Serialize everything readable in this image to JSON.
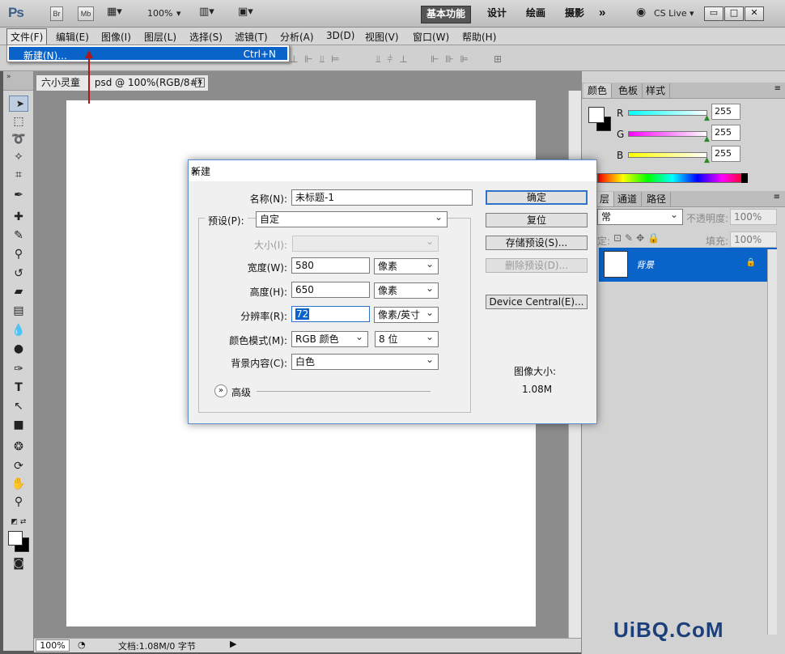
{
  "appbar": {
    "logo": "Ps",
    "br": "Br",
    "mb": "Mb",
    "zoom": "100%",
    "workspaces": [
      "基本功能",
      "设计",
      "绘画",
      "摄影"
    ],
    "more": "»",
    "cs_live": "CS Live",
    "win_min": "▭",
    "win_restore": "□",
    "win_close": "✕"
  },
  "menu": [
    "文件(F)",
    "编辑(E)",
    "图像(I)",
    "图层(L)",
    "选择(S)",
    "滤镜(T)",
    "分析(A)",
    "3D(D)",
    "视图(V)",
    "窗口(W)",
    "帮助(H)"
  ],
  "dropdown": {
    "item": "新建(N)...",
    "shortcut": "Ctrl+N"
  },
  "document": {
    "tab_title": "六小灵童",
    "tab_suffix": "psd @ 100%(RGB/8#)",
    "zoom": "100%",
    "status": "文档:1.08M/0 字节"
  },
  "colorpanel": {
    "tabs": [
      "颜色",
      "色板",
      "样式"
    ],
    "channels": [
      {
        "label": "R",
        "value": "255"
      },
      {
        "label": "G",
        "value": "255"
      },
      {
        "label": "B",
        "value": "255"
      }
    ]
  },
  "layerspanel": {
    "tabs": [
      "层",
      "通道",
      "路径"
    ],
    "blend": "常",
    "opacity_label": "不透明度:",
    "opacity": "100%",
    "lock_label": "定:",
    "fill_label": "填充:",
    "fill": "100%",
    "layer_name": "背景"
  },
  "dialog": {
    "title": "新建",
    "name_label": "名称(N):",
    "name_value": "未标题-1",
    "preset_label": "预设(P):",
    "preset_value": "自定",
    "size_label": "大小(I):",
    "width_label": "宽度(W):",
    "width_value": "580",
    "width_unit": "像素",
    "height_label": "高度(H):",
    "height_value": "650",
    "height_unit": "像素",
    "resolution_label": "分辨率(R):",
    "resolution_value": "72",
    "resolution_unit": "像素/英寸",
    "colormode_label": "颜色模式(M):",
    "colormode_value": "RGB 颜色",
    "bitdepth_value": "8 位",
    "bg_label": "背景内容(C):",
    "bg_value": "白色",
    "advanced_label": "高级",
    "buttons": {
      "ok": "确定",
      "reset": "复位",
      "save_preset": "存储预设(S)...",
      "delete_preset": "删除预设(D)...",
      "device_central": "Device Central(E)..."
    },
    "image_size_label": "图像大小:",
    "image_size_value": "1.08M"
  },
  "watermark": "UiBQ.CoM",
  "colors": {
    "accent": "#0a63c9",
    "dialog_border": "#5c8ed1",
    "arrow": "#b01818"
  }
}
